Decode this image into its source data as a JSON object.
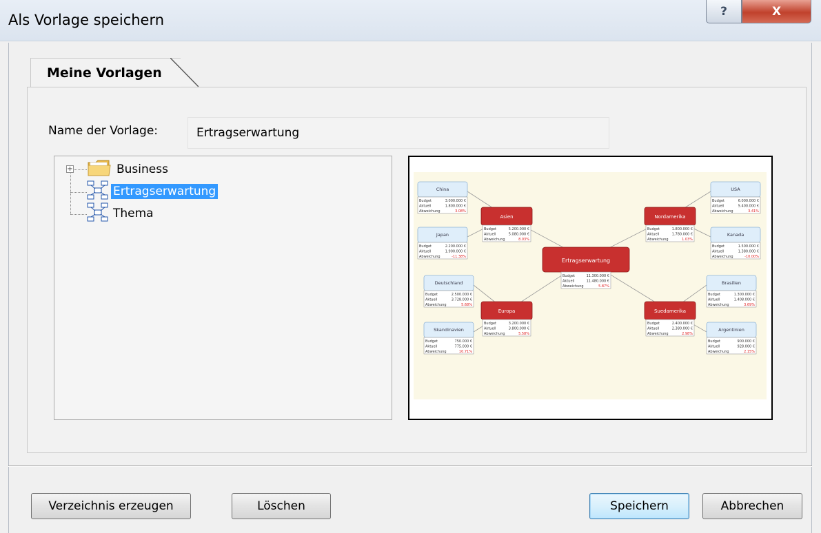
{
  "window": {
    "title": "Als Vorlage speichern",
    "help_glyph": "?",
    "close_glyph": "X"
  },
  "tab": {
    "label": "Meine Vorlagen"
  },
  "form": {
    "name_label": "Name der Vorlage:",
    "name_value": "Ertragserwartung"
  },
  "tree": {
    "expander_glyph": "+",
    "items": [
      {
        "label": "Business",
        "icon": "folder-icon",
        "expandable": true,
        "selected": false
      },
      {
        "label": "Ertragserwartung",
        "icon": "mindmap-template-icon",
        "expandable": false,
        "selected": true
      },
      {
        "label": "Thema",
        "icon": "mindmap-template-icon",
        "expandable": false,
        "selected": false
      }
    ]
  },
  "preview": {
    "center": {
      "label": "Ertragserwartung",
      "rows": [
        [
          "Budget",
          "11.300.000 €"
        ],
        [
          "Aktuell",
          "11.480.000 €"
        ],
        [
          "Abweichung",
          "5.87%"
        ]
      ]
    },
    "nodes": [
      {
        "label": "Asien",
        "rows": [
          [
            "Budget",
            "5.200.000 €"
          ],
          [
            "Aktuell",
            "5.080.000 €"
          ],
          [
            "Abweichung",
            "8.03%"
          ]
        ]
      },
      {
        "label": "Nordamerika",
        "rows": [
          [
            "Budget",
            "1.800.000 €"
          ],
          [
            "Aktuell",
            "1.780.000 €"
          ],
          [
            "Abweichung",
            "1.03%"
          ]
        ]
      },
      {
        "label": "Europa",
        "rows": [
          [
            "Budget",
            "3.200.000 €"
          ],
          [
            "Aktuell",
            "3.800.000 €"
          ],
          [
            "Abweichung",
            "5.58%"
          ]
        ]
      },
      {
        "label": "Suedamerika",
        "rows": [
          [
            "Budget",
            "2.400.000 €"
          ],
          [
            "Aktuell",
            "2.380.000 €"
          ],
          [
            "Abweichung",
            "2.98%"
          ]
        ]
      }
    ],
    "leaves": [
      {
        "label": "China",
        "rows": [
          [
            "Budget",
            "3.000.000 €"
          ],
          [
            "Aktuell",
            "1.800.000 €"
          ],
          [
            "Abweichung",
            "3.08%"
          ]
        ]
      },
      {
        "label": "Japan",
        "rows": [
          [
            "Budget",
            "2.200.000 €"
          ],
          [
            "Aktuell",
            "1.900.000 €"
          ],
          [
            "Abweichung",
            "-11.38%"
          ]
        ]
      },
      {
        "label": "Deutschland",
        "rows": [
          [
            "Budget",
            "2.500.000 €"
          ],
          [
            "Aktuell",
            "3.728.000 €"
          ],
          [
            "Abweichung",
            "5.68%"
          ]
        ]
      },
      {
        "label": "Skandinavien",
        "rows": [
          [
            "Budget",
            "750.000 €"
          ],
          [
            "Aktuell",
            "775.000 €"
          ],
          [
            "Abweichung",
            "10.71%"
          ]
        ]
      },
      {
        "label": "USA",
        "rows": [
          [
            "Budget",
            "6.000.000 €"
          ],
          [
            "Aktuell",
            "5.400.000 €"
          ],
          [
            "Abweichung",
            "3.41%"
          ]
        ]
      },
      {
        "label": "Kanada",
        "rows": [
          [
            "Budget",
            "1.500.000 €"
          ],
          [
            "Aktuell",
            "1.380.000 €"
          ],
          [
            "Abweichung",
            "-10.00%"
          ]
        ]
      },
      {
        "label": "Brasilien",
        "rows": [
          [
            "Budget",
            "1.300.000 €"
          ],
          [
            "Aktuell",
            "1.408.000 €"
          ],
          [
            "Abweichung",
            "3.69%"
          ]
        ]
      },
      {
        "label": "Argentinien",
        "rows": [
          [
            "Budget",
            "900.000 €"
          ],
          [
            "Aktuell",
            "928.000 €"
          ],
          [
            "Abweichung",
            "2.15%"
          ]
        ]
      }
    ],
    "colors": {
      "node_red": "#c8302f",
      "leaf_blue": "#dfeefa",
      "background": "#fbf8e6",
      "negative": "#e02020"
    }
  },
  "buttons": {
    "create_dir": "Verzeichnis erzeugen",
    "delete": "Löschen",
    "save": "Speichern",
    "cancel": "Abbrechen"
  }
}
